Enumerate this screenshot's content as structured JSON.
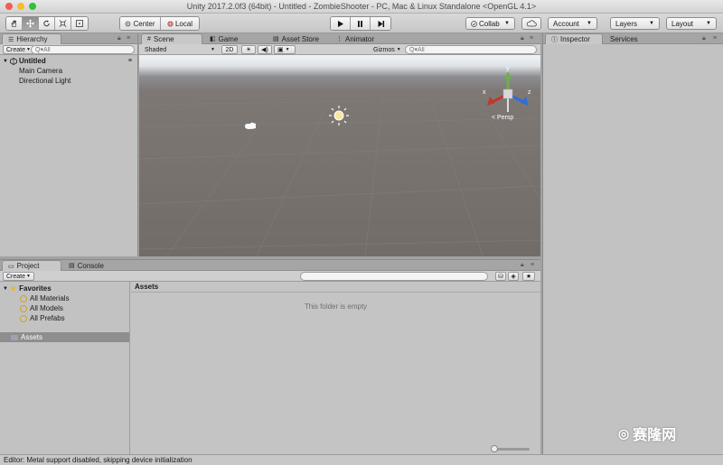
{
  "window": {
    "title": "Unity 2017.2.0f3 (64bit) - Untitled - ZombieShooter - PC, Mac & Linux Standalone <OpenGL 4.1>"
  },
  "toolbar": {
    "tools": [
      {
        "name": "hand-tool",
        "icon": "hand-icon"
      },
      {
        "name": "move-tool",
        "icon": "move-icon"
      },
      {
        "name": "rotate-tool",
        "icon": "rotate-icon"
      },
      {
        "name": "scale-tool",
        "icon": "scale-icon"
      },
      {
        "name": "rect-tool",
        "icon": "rect-icon"
      }
    ],
    "pivot_label": "Center",
    "pivot_icon": "pivot-icon",
    "space_label": "Local",
    "space_icon": "globe-icon",
    "play_icon": "play-icon",
    "pause_icon": "pause-icon",
    "step_icon": "step-icon",
    "collab_label": "Collab",
    "cloud_icon": "cloud-icon",
    "account_label": "Account",
    "layers_label": "Layers",
    "layout_label": "Layout"
  },
  "hierarchy": {
    "tab_label": "Hierarchy",
    "create_label": "Create",
    "search_placeholder": "Q▾All",
    "scene_name": "Untitled",
    "items": [
      "Main Camera",
      "Directional Light"
    ]
  },
  "scene": {
    "tabs": [
      {
        "label": "Scene",
        "icon": "scene-icon"
      },
      {
        "label": "Game",
        "icon": "game-icon"
      },
      {
        "label": "Asset Store",
        "icon": "store-icon"
      },
      {
        "label": "Animator",
        "icon": "animator-icon"
      }
    ],
    "shading_label": "Shaded",
    "mode_2d_label": "2D",
    "gizmos_label": "Gizmos",
    "search_placeholder": "Q▾All",
    "persp_label": "< Persp",
    "axis_labels": {
      "x": "x",
      "y": "y",
      "z": "z"
    }
  },
  "inspector": {
    "tabs": [
      "Inspector",
      "Services"
    ]
  },
  "project": {
    "tabs": [
      "Project",
      "Console"
    ],
    "create_label": "Create",
    "favorites_label": "Favorites",
    "favorite_items": [
      "All Materials",
      "All Models",
      "All Prefabs"
    ],
    "assets_label": "Assets",
    "assets_header": "Assets",
    "empty_message": "This folder is empty"
  },
  "watermark": {
    "text": "赛隆网"
  },
  "status": {
    "message": "Editor: Metal support disabled, skipping device initialization"
  },
  "colors": {
    "accent": "#3c80d8",
    "gizmo_x": "#c0392b",
    "gizmo_y": "#6ab04c",
    "gizmo_z": "#2e6fd6"
  }
}
